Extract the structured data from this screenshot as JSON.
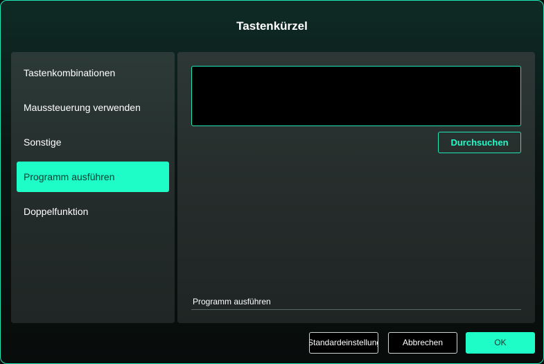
{
  "dialog": {
    "title": "Tastenkürzel"
  },
  "sidebar": {
    "items": [
      {
        "label": "Tastenkombinationen",
        "active": false
      },
      {
        "label": "Maussteuerung verwenden",
        "active": false
      },
      {
        "label": "Sonstige",
        "active": false
      },
      {
        "label": "Programm ausführen",
        "active": true
      },
      {
        "label": "Doppelfunktion",
        "active": false
      }
    ]
  },
  "main": {
    "path_value": "",
    "browse_label": "Durchsuchen",
    "field_label": "Programm ausführen"
  },
  "footer": {
    "default_label": "Standardeinstellungen",
    "cancel_label": "Abbrechen",
    "ok_label": "OK"
  },
  "colors": {
    "accent": "#1efcc8",
    "border_accent": "#1ee8b8",
    "background": "#0b1513"
  }
}
